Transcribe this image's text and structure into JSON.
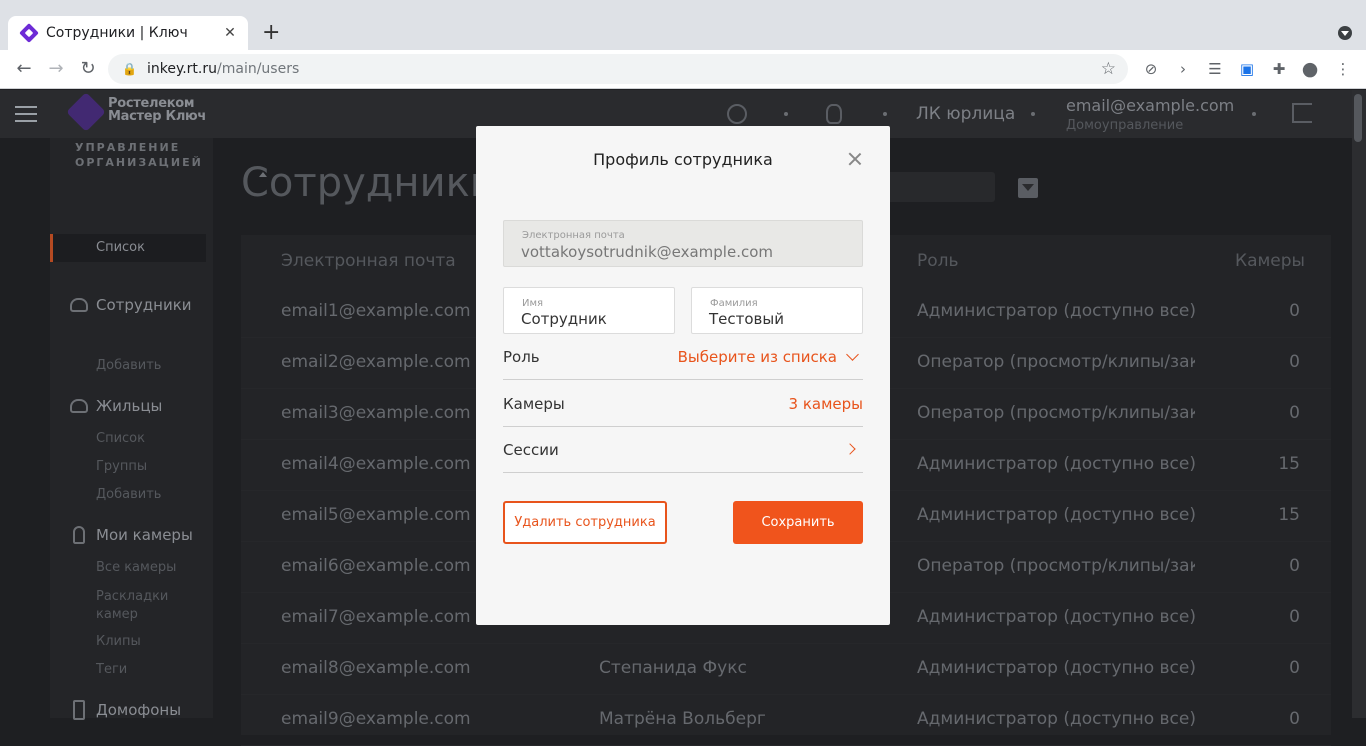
{
  "browser": {
    "tab_title": "Сотрудники | Ключ",
    "url_host": "inkey.rt.ru",
    "url_path": "/main/users"
  },
  "header": {
    "logo_line1": "Ростелеком",
    "logo_line2": "Мастер Ключ",
    "account_type": "ЛК юрлица",
    "user_email": "email@example.com",
    "user_org": "Домоуправление"
  },
  "sidebar": {
    "section_title_line1": "УПРАВЛЕНИЕ",
    "section_title_line2": "ОРГАНИЗАЦИЕЙ",
    "employees": {
      "label": "Сотрудники",
      "items": [
        "Список",
        "Добавить"
      ]
    },
    "residents": {
      "label": "Жильцы",
      "items": [
        "Список",
        "Группы",
        "Добавить"
      ]
    },
    "cameras": {
      "label": "Мои камеры",
      "items": [
        "Все камеры",
        "Раскладки",
        "камер",
        "Клипы",
        "Теги"
      ]
    },
    "intercoms": {
      "label": "Домофоны"
    }
  },
  "main": {
    "title": "Сотрудники",
    "table": {
      "columns": [
        "Электронная почта",
        "Роль",
        "Камеры"
      ],
      "rows": [
        {
          "email": "email1@example.com",
          "name": "",
          "role": "Администратор (доступно все)",
          "cameras": "0"
        },
        {
          "email": "email2@example.com",
          "name": "",
          "role": "Оператор (просмотр/клипы/закл",
          "cameras": "0"
        },
        {
          "email": "email3@example.com",
          "name": "",
          "role": "Оператор (просмотр/клипы/закл",
          "cameras": "0"
        },
        {
          "email": "email4@example.com",
          "name": "",
          "role": "Администратор (доступно все)",
          "cameras": "15"
        },
        {
          "email": "email5@example.com",
          "name": "",
          "role": "Администратор (доступно все)",
          "cameras": "15"
        },
        {
          "email": "email6@example.com",
          "name": "",
          "role": "Оператор (просмотр/клипы/закл",
          "cameras": "0"
        },
        {
          "email": "email7@example.com",
          "name": "",
          "role": "Администратор (доступно все)",
          "cameras": "0"
        },
        {
          "email": "email8@example.com",
          "name": "Степанида Фукс",
          "role": "Администратор (доступно все)",
          "cameras": "0"
        },
        {
          "email": "email9@example.com",
          "name": "Матрёна Вольберг",
          "role": "Администратор (доступно все)",
          "cameras": "0"
        }
      ]
    }
  },
  "modal": {
    "title": "Профиль сотрудника",
    "email_label": "Электронная почта",
    "email_value": "vottakoysotrudnik@example.com",
    "first_name_label": "Имя",
    "first_name_value": "Сотрудник",
    "last_name_label": "Фамилия",
    "last_name_value": "Тестовый",
    "role_label": "Роль",
    "role_value": "Выберите из списка",
    "cameras_label": "Камеры",
    "cameras_value": "3 камеры",
    "sessions_label": "Сессии",
    "delete_button": "Удалить сотрудника",
    "save_button": "Сохранить"
  },
  "colors": {
    "accent": "#e8541c",
    "brand": "#4b2a8a"
  }
}
